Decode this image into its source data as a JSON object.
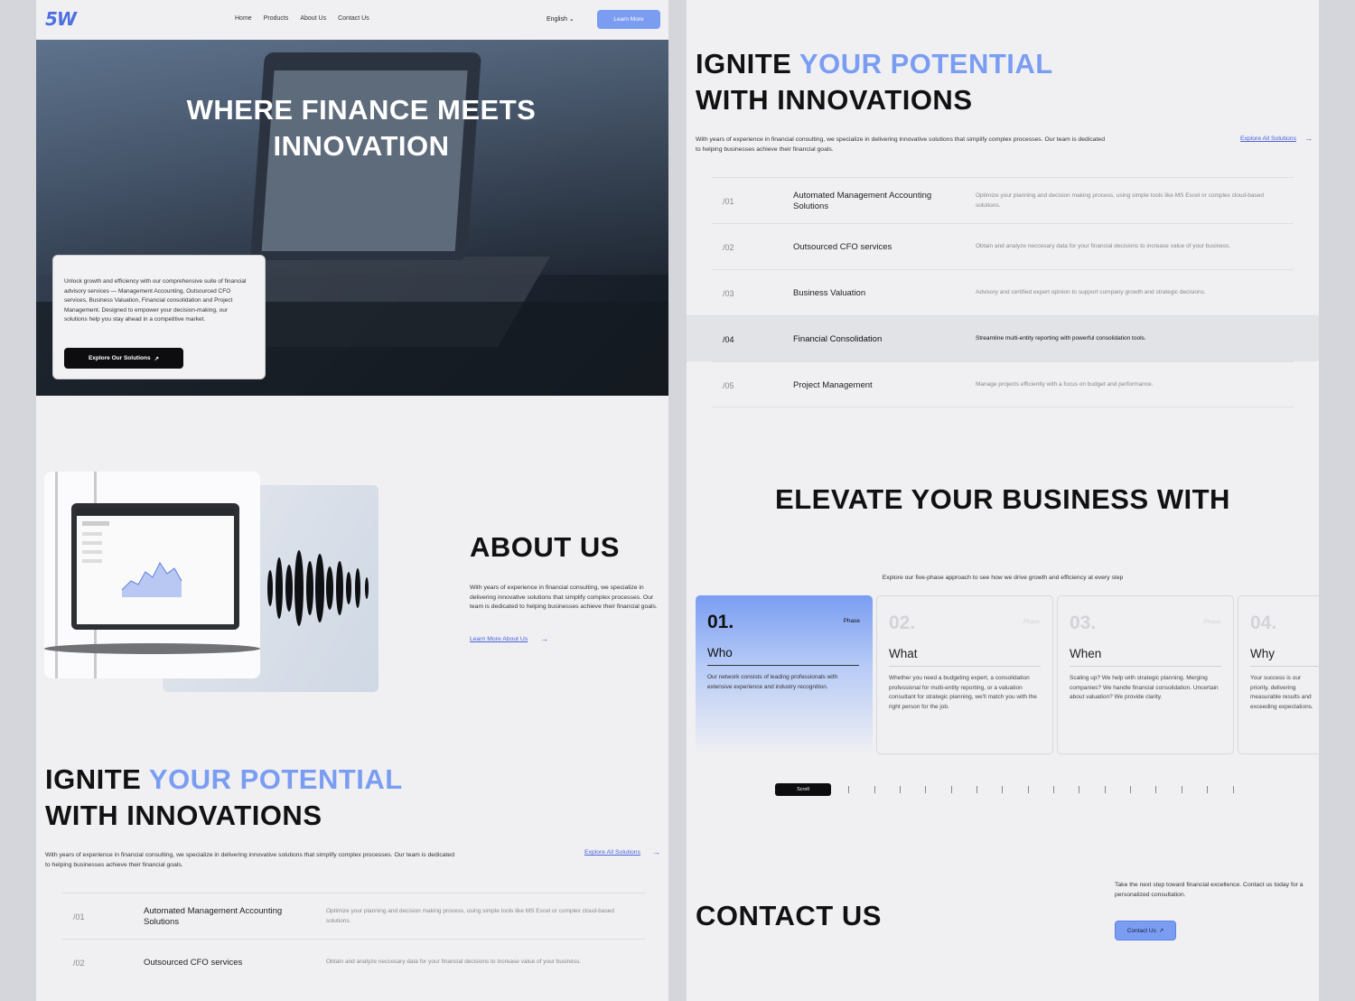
{
  "header": {
    "logo": "5W",
    "nav": [
      "Home",
      "Products",
      "About Us",
      "Contact Us"
    ],
    "language": "English",
    "cta": "Learn More"
  },
  "hero": {
    "title": "WHERE FINANCE MEETS INNOVATION",
    "card_text": "Unlock growth and efficiency with our comprehensive suite of financial advisory services — Management Accounting, Outsourced CFO services, Business Valuation, Financial consolidation and Project Management. Designed to empower your decision-making, our solutions help you stay ahead in a competitive market.",
    "card_button": "Explore Our Solutions"
  },
  "about": {
    "title": "ABOUT US",
    "text": "With years of experience in financial consulting, we specialize in delivering innovative solutions that simplify complex processes. Our team is dedicated to helping businesses achieve their financial goals.",
    "link": "Learn More About Us"
  },
  "ignite": {
    "title_1": "IGNITE ",
    "title_accent": "YOUR POTENTIAL",
    "title_2": "WITH INNOVATIONS",
    "text": "With years of experience in financial consulting, we specialize in delivering innovative solutions that simplify complex processes. Our team is dedicated to helping businesses achieve their financial goals.",
    "link": "Explore All Solutions",
    "services": [
      {
        "num": "/01",
        "name": "Automated Management Accounting Solutions",
        "desc": "Optimize your planning and decision making process, using simple tools like MS Excel or complex cloud-based solutions."
      },
      {
        "num": "/02",
        "name": "Outsourced CFO services",
        "desc": "Obtain and analyze neccesary data for your financial decisions to increase value of your business."
      },
      {
        "num": "/03",
        "name": "Business Valuation",
        "desc": "Advisory and certified expert opinion to support company growth and strategic decisions."
      },
      {
        "num": "/04",
        "name": "Financial Consolidation",
        "desc": "Streamline multi-entity reporting with powerful consolidation tools."
      },
      {
        "num": "/05",
        "name": "Project Management",
        "desc": "Manage projects efficiently with a focus on budget and performance."
      }
    ]
  },
  "elevate": {
    "title": "ELEVATE YOUR BUSINESS WITH",
    "subtitle": "Explore our five-phase approach to see how we drive growth and efficiency at every step",
    "phase_label": "Phase",
    "phases": [
      {
        "num": "01.",
        "name": "Who",
        "text": "Our network consists of leading professionals with extensive experience and industry recognition."
      },
      {
        "num": "02.",
        "name": "What",
        "text": "Whether you need a budgeting expert, a consolidation professional for multi-entity reporting, or a valuation consultant for strategic planning, we'll match you with the right person for the job."
      },
      {
        "num": "03.",
        "name": "When",
        "text": "Scaling up? We help with strategic planning. Merging companies? We handle financial consolidation. Uncertain about valuation? We provide clarity."
      },
      {
        "num": "04.",
        "name": "Why",
        "text": "Your success is our priority, delivering measurable results and exceeding expectations."
      }
    ],
    "scroll": "Scroll"
  },
  "contact": {
    "title": "CONTACT US",
    "text": "Take the next step toward financial excellence. Contact us today for a personalized consultation.",
    "button": "Contact Us"
  },
  "colors": {
    "accent": "#7a9df2",
    "link": "#4a63d8",
    "dark": "#0d0d10",
    "background": "#f0f0f3"
  }
}
